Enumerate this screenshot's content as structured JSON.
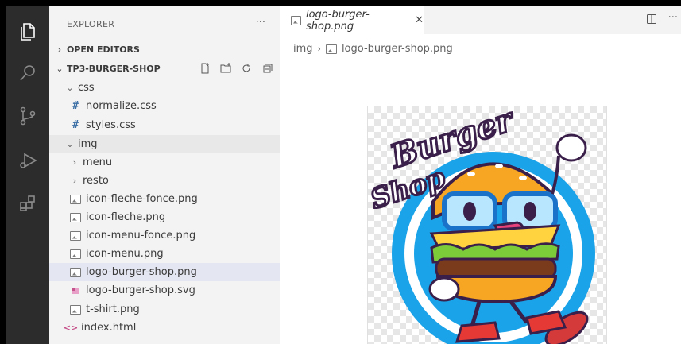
{
  "sidebar": {
    "title": "EXPLORER",
    "more": "···",
    "open_editors": "OPEN EDITORS",
    "project": "TP3-BURGER-SHOP",
    "tree": [
      {
        "label": "css",
        "type": "folder-open",
        "depth": 1
      },
      {
        "label": "normalize.css",
        "type": "css",
        "depth": 2
      },
      {
        "label": "styles.css",
        "type": "css",
        "depth": 2
      },
      {
        "label": "img",
        "type": "folder-open",
        "depth": 1
      },
      {
        "label": "menu",
        "type": "folder",
        "depth": 2
      },
      {
        "label": "resto",
        "type": "folder",
        "depth": 2
      },
      {
        "label": "icon-fleche-fonce.png",
        "type": "image",
        "depth": 2
      },
      {
        "label": "icon-fleche.png",
        "type": "image",
        "depth": 2
      },
      {
        "label": "icon-menu-fonce.png",
        "type": "image",
        "depth": 2
      },
      {
        "label": "icon-menu.png",
        "type": "image",
        "depth": 2
      },
      {
        "label": "logo-burger-shop.png",
        "type": "image",
        "depth": 2
      },
      {
        "label": "logo-burger-shop.svg",
        "type": "svg",
        "depth": 2
      },
      {
        "label": "t-shirt.png",
        "type": "image",
        "depth": 2
      },
      {
        "label": "index.html",
        "type": "html",
        "depth": 1
      }
    ]
  },
  "editor": {
    "tab_label": "logo-burger-shop.png",
    "breadcrumb_folder": "img",
    "breadcrumb_file": "logo-burger-shop.png",
    "logo_text_top": "Burger",
    "logo_text_bottom": "Shop"
  }
}
